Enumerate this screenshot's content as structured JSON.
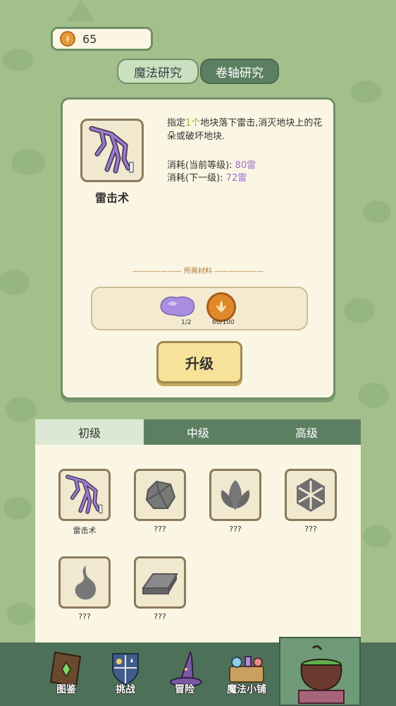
{
  "currency": {
    "amount": "65",
    "icon": "coin-icon"
  },
  "top_tabs": [
    {
      "label": "魔法研究",
      "active": true
    },
    {
      "label": "卷轴研究",
      "active": false
    }
  ],
  "detail": {
    "spell_name": "雷击术",
    "desc_prefix": "指定",
    "desc_highlight": "1个",
    "desc_suffix": "地块落下雷击,消灭地块上的花朵或破坏地块.",
    "cost_current_label": "消耗(当前等级):",
    "cost_current_value": "80雷",
    "cost_next_label": "消耗(下一级):",
    "cost_next_value": "72雷",
    "materials_title": "——————— 所需材料 ———————",
    "material_1_count": "1/2",
    "material_2_count": "60/100",
    "upgrade_label": "升级"
  },
  "tiers": [
    {
      "label": "初级",
      "active": true
    },
    {
      "label": "中级",
      "active": false
    },
    {
      "label": "高级",
      "active": false
    }
  ],
  "spells": [
    {
      "label": "雷击术",
      "icon": "lightning-icon"
    },
    {
      "label": "???",
      "icon": "rock-icon"
    },
    {
      "label": "???",
      "icon": "leaf-icon"
    },
    {
      "label": "???",
      "icon": "snowflake-icon"
    },
    {
      "label": "???",
      "icon": "flame-icon"
    },
    {
      "label": "???",
      "icon": "ingot-icon"
    }
  ],
  "nav": [
    {
      "label": "图鉴",
      "icon": "book-icon"
    },
    {
      "label": "挑战",
      "icon": "shield-icon"
    },
    {
      "label": "冒险",
      "icon": "wizard-hat-icon"
    },
    {
      "label": "魔法小铺",
      "icon": "shop-icon"
    },
    {
      "label": "",
      "icon": "cauldron-icon",
      "active": true
    }
  ],
  "colors": {
    "background": "#a3c08c",
    "panel": "#fbf6e3",
    "accent_green": "#5c7f62",
    "purple": "#9b6fcb",
    "highlight_green": "#8ab83c"
  }
}
